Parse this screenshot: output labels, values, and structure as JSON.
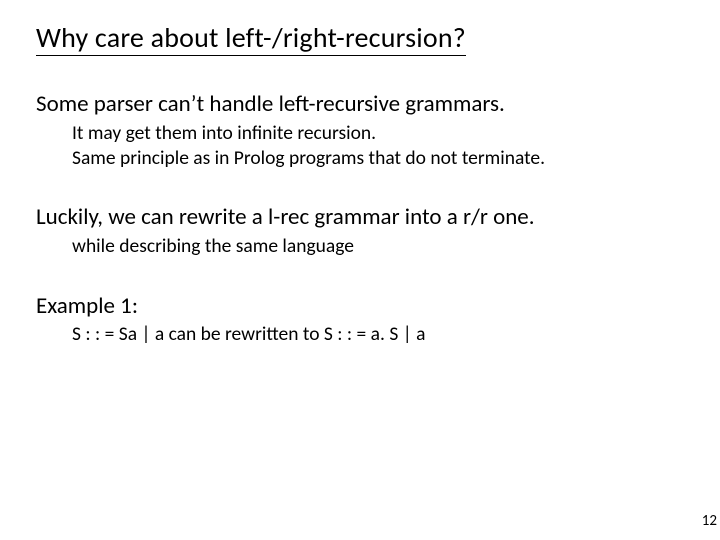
{
  "title": "Why care about left-/right-recursion?",
  "p1": "Some parser can’t handle left-recursive grammars.",
  "p1s1": "It may get them into infinite recursion.",
  "p1s2": "Same principle as in Prolog programs that do not terminate.",
  "p2": "Luckily, we can rewrite a l-rec grammar into a r/r one.",
  "p2s1": "while describing the same language",
  "p3": "Example 1:",
  "p3s1": "S : : = Sa | a   can be rewritten to   S : : = a. S | a",
  "page_number": "12"
}
